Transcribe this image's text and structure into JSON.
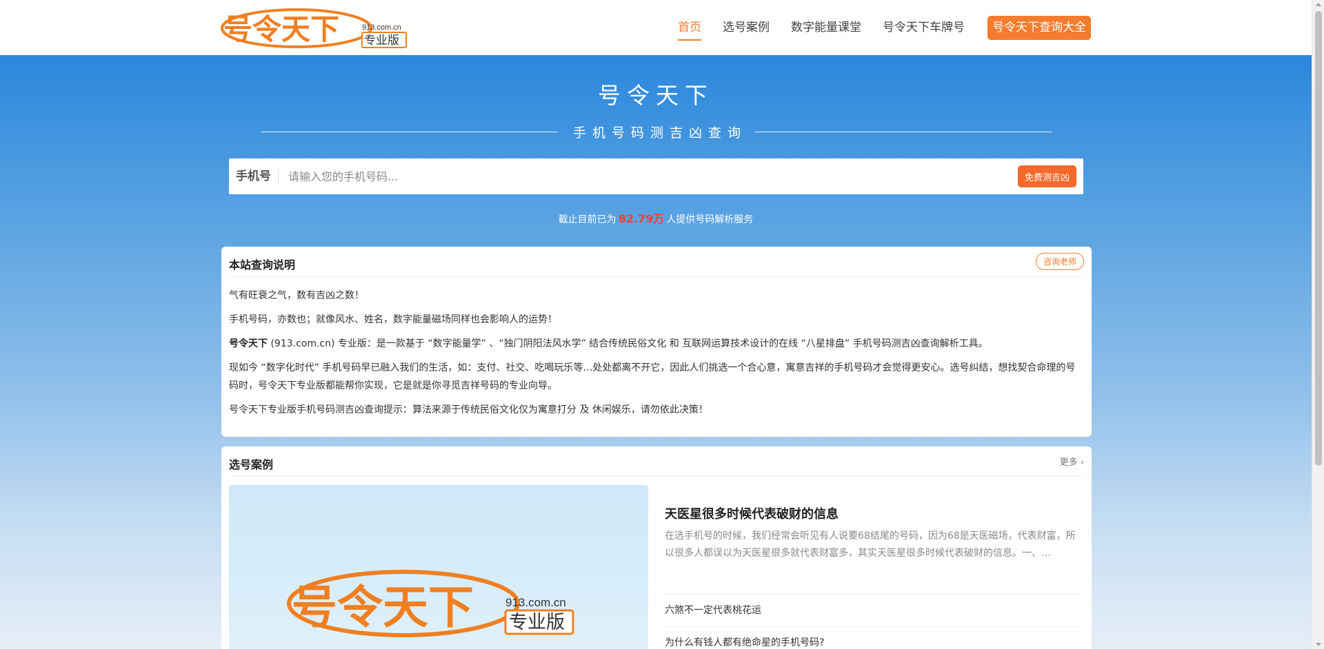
{
  "header": {
    "logo": {
      "main_text": "号令天下",
      "domain": "913.com.cn",
      "edition": "专业版"
    },
    "nav": [
      {
        "label": "首页",
        "active": true
      },
      {
        "label": "选号案例",
        "active": false
      },
      {
        "label": "数字能量课堂",
        "active": false
      },
      {
        "label": "号令天下车牌号",
        "active": false
      }
    ],
    "cta_label": "号令天下查询大全"
  },
  "hero": {
    "title": "号令天下",
    "subtitle": "手机号码测吉凶查询",
    "search": {
      "label": "手机号",
      "placeholder": "请输入您的手机号码...",
      "button_label": "免费测吉凶"
    },
    "stat": {
      "prefix": "截止目前已为",
      "count": "82.79万",
      "suffix": "人提供号码解析服务"
    }
  },
  "intro": {
    "title": "本站查询说明",
    "consult_label": "咨询老师",
    "p1": "气有旺衰之气，数有吉凶之数！",
    "p2": "手机号码，亦数也；就像风水、姓名，数字能量磁场同样也会影响人的运势！",
    "p3_brand": "号令天下",
    "p3_rest": " (913.com.cn) 专业版：是一款基于 “数字能量学” 、“独门阴阳法风水学” 结合传统民俗文化 和 互联网运算技术设计的在线 “八星排盘” 手机号码测吉凶查询解析工具。",
    "p4": "现如今 “数字化时代” 手机号码早已融入我们的生活，如：支付、社交、吃喝玩乐等…处处都离不开它，因此人们挑选一个合心意，寓意吉祥的手机号码才会觉得更安心。选号纠结，想找契合命理的号码时，号令天下专业版都能帮你实现，它是就是你寻觅吉祥号码的专业向导。",
    "p5": "号令天下专业版手机号码测吉凶查询提示：算法来源于传统民俗文化仅为寓意打分 及 休闲娱乐，请勿依此决策！"
  },
  "cases": {
    "title": "选号案例",
    "more_label": "更多",
    "featured": {
      "title": "天医星很多时候代表破财的信息",
      "desc": "在选手机号的时候，我们经常会听见有人说要68结尾的号码，因为68是天医磁场，代表财富，所以很多人都误以为天医星很多就代表财富多，其实天医星很多时候代表破财的信息。一、…"
    },
    "items": [
      "六煞不一定代表桃花运",
      "为什么有钱人都有绝命星的手机号码?"
    ]
  },
  "colors": {
    "accent": "#f57c2e",
    "hero_top": "#2b87dc",
    "stat_highlight": "#ff3b30"
  }
}
